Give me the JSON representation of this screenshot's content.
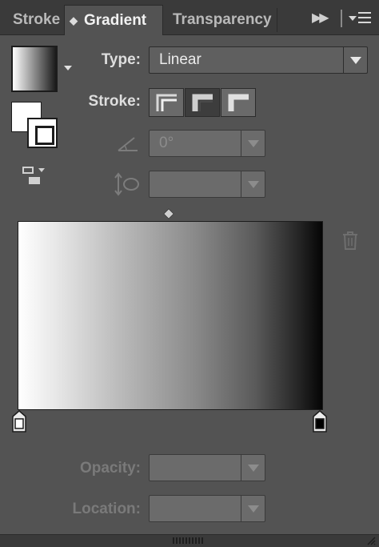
{
  "tabs": [
    {
      "label": "Stroke",
      "active": false
    },
    {
      "label": "Gradient",
      "active": true
    },
    {
      "label": "Transparency",
      "active": false
    }
  ],
  "header_icons": [
    "collapse-icon",
    "panel-menu-icon"
  ],
  "swatches": {
    "gradient_swatch": "gradient-swatch",
    "fill": "#ffffff",
    "stroke": "#ffffff",
    "swap_icon": "swap-fill-stroke-icon"
  },
  "type": {
    "label": "Type:",
    "value": "Linear"
  },
  "stroke": {
    "label": "Stroke:",
    "options": [
      "apply-within-stroke",
      "apply-along-stroke",
      "apply-across-stroke"
    ],
    "selected": 1
  },
  "angle": {
    "value": "0°",
    "enabled": false
  },
  "aspect_ratio": {
    "value": "",
    "enabled": false
  },
  "gradient": {
    "start_color": "#ffffff",
    "end_color": "#000000",
    "midpoint": 0.5
  },
  "stops": [
    {
      "name": "start",
      "color": "#ffffff",
      "location": 0
    },
    {
      "name": "end",
      "color": "#000000",
      "location": 1
    }
  ],
  "opacity": {
    "label": "Opacity:",
    "value": "",
    "enabled": false
  },
  "location": {
    "label": "Location:",
    "value": "",
    "enabled": false
  },
  "colors": {
    "panel": "#535353",
    "tabbar": "#3a3a3a",
    "field": "#6b6b6b"
  }
}
